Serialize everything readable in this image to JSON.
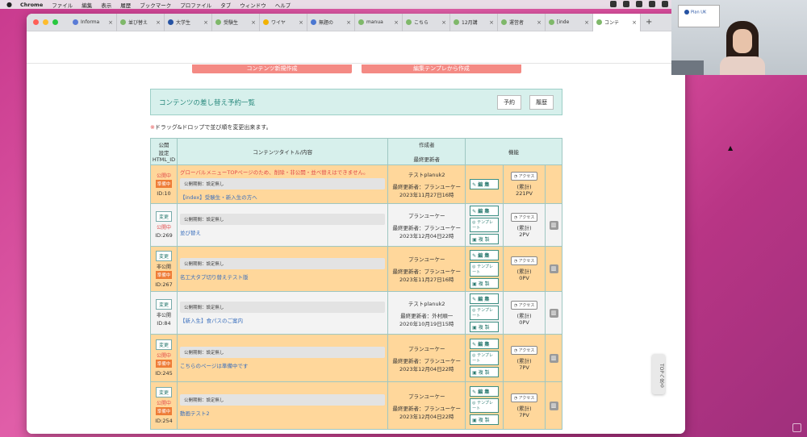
{
  "menubar": {
    "app": "Chrome",
    "items": [
      "ファイル",
      "編集",
      "表示",
      "履歴",
      "ブックマーク",
      "プロファイル",
      "タブ",
      "ウィンドウ",
      "ヘルプ"
    ]
  },
  "tabs": [
    {
      "label": "Informa",
      "color": "#5a7bd6"
    },
    {
      "label": "並び替え",
      "color": "#7fb86a"
    },
    {
      "label": "大学生",
      "color": "#2653a3"
    },
    {
      "label": "受験生",
      "color": "#7fb86a"
    },
    {
      "label": "ワイヤ",
      "color": "#f2b200"
    },
    {
      "label": "無題の",
      "color": "#4b77d1"
    },
    {
      "label": "manua",
      "color": "#7fb86a"
    },
    {
      "label": "こちら",
      "color": "#7fb86a"
    },
    {
      "label": "12月講",
      "color": "#7fb86a"
    },
    {
      "label": "運営者",
      "color": "#7fb86a"
    },
    {
      "label": "[inde",
      "color": "#7fb86a"
    },
    {
      "label": "コンテ",
      "color": "#7fb86a"
    }
  ],
  "page": {
    "btn_new": "コンテンツ新規作成",
    "btn_tpl": "編集テンプレから作成",
    "section_title": "コンテンツの差し替え予約一覧",
    "btn_reserve": "予約",
    "btn_history": "履歴",
    "note_mark": "※",
    "note": "ドラッグ&ドロップで並び順を変更出来ます。"
  },
  "table": {
    "headers": {
      "settings_1": "公開",
      "settings_2": "設定",
      "settings_3": "HTML_ID",
      "title": "コンテンツタイトル/内容",
      "author_1": "作成者",
      "author_2": "最終更新者",
      "function": "機能"
    },
    "labels": {
      "change": "変更",
      "edit": "編 集",
      "template": "テンプレート",
      "copy": "複 製",
      "access": "アクセス",
      "total": "(累計)",
      "top": "TOPへ戻る"
    },
    "rows": [
      {
        "change": "",
        "status": "公開中",
        "prep": "準備中",
        "id": "ID:10",
        "warning": "グローバルメニューTOPページのため、削除・非公開・並べ替えはできません。",
        "period": "公開期間：設定無し",
        "title": "【index】受験生・新入生の方へ",
        "creator": "テストplanuk2",
        "updater": "最終更新者：プランユーケー",
        "date": "2023年11月27日16時",
        "pv": "221PV"
      },
      {
        "change": "変更",
        "status": "公開中",
        "prep": "",
        "id": "ID:269",
        "warning": "",
        "period": "公開期間：設定無し",
        "title": "並び替え",
        "creator": "プランユーケー",
        "updater": "最終更新者：プランユーケー",
        "date": "2023年12月04日22時",
        "pv": "2PV"
      },
      {
        "change": "変更",
        "status": "非公開",
        "prep": "準備中",
        "id": "ID:267",
        "warning": "",
        "period": "公開期間：設定無し",
        "title": "名工大タブ切り替えテスト版",
        "creator": "プランユーケー",
        "updater": "最終更新者：プランユーケー",
        "date": "2023年11月27日16時",
        "pv": "0PV"
      },
      {
        "change": "変更",
        "status": "非公開",
        "prep": "",
        "id": "ID:84",
        "warning": "",
        "period": "公開期間：設定無し",
        "title": "【新入生】食パスのご案内",
        "creator": "テストplanuk2",
        "updater": "最終更新者：外村順一",
        "date": "2020年10月19日15時",
        "pv": "0PV"
      },
      {
        "change": "変更",
        "status": "公開中",
        "prep": "準備中",
        "id": "ID:245",
        "warning": "",
        "period": "公開期間：設定無し",
        "title": "こちらのページは準備中です",
        "creator": "プランユーケー",
        "updater": "最終更新者：プランユーケー",
        "date": "2023年12月04日22時",
        "pv": "7PV"
      },
      {
        "change": "変更",
        "status": "公開中",
        "prep": "準備中",
        "id": "ID:254",
        "warning": "",
        "period": "公開期間：設定無し",
        "title": "動画テスト2",
        "creator": "プランユーケー",
        "updater": "最終更新者：プランユーケー",
        "date": "2023年12月04日22時",
        "pv": "7PV"
      }
    ]
  },
  "cam": {
    "logo": "Plan UK"
  }
}
